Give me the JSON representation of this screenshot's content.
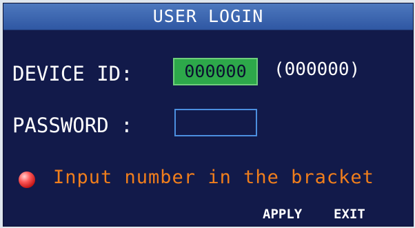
{
  "header": {
    "title": "USER LOGIN"
  },
  "form": {
    "device_id_label": "DEVICE ID:",
    "device_id_value": "000000",
    "device_id_hint": "(000000)",
    "password_label": "PASSWORD :",
    "password_value": ""
  },
  "message": {
    "icon": "red-dot-icon",
    "text": "Input number in the bracket"
  },
  "buttons": {
    "apply": "APPLY",
    "exit": "EXIT"
  },
  "colors": {
    "background": "#121a4a",
    "titlebar": "#3a64ad",
    "input_active": "#2da84a",
    "input_border": "#4c8fe0",
    "message": "#f07e1c",
    "indicator": "#e02424"
  }
}
